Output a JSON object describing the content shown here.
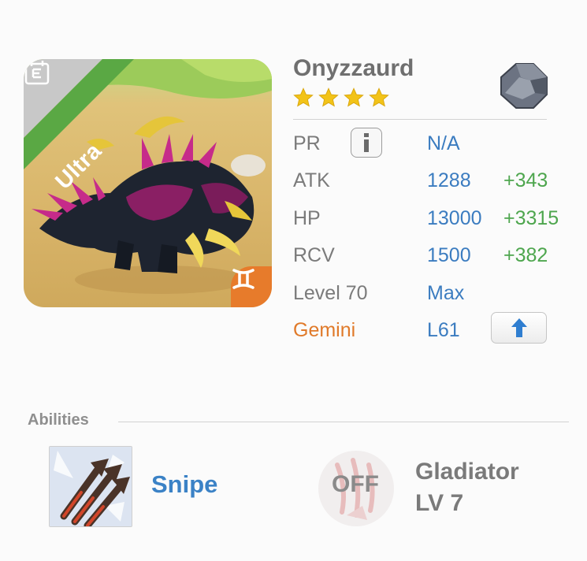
{
  "monster": {
    "name": "Onyzzaurd",
    "rarity_label": "Ultra",
    "star_count": 4,
    "element_icon": "dark-stone-icon",
    "zodiac_icon": "gemini-icon"
  },
  "stats": {
    "pr": {
      "label": "PR",
      "value": "N/A"
    },
    "atk": {
      "label": "ATK",
      "value": "1288",
      "bonus": "+343"
    },
    "hp": {
      "label": "HP",
      "value": "13000",
      "bonus": "+3315"
    },
    "rcv": {
      "label": "RCV",
      "value": "1500",
      "bonus": "+382"
    },
    "level": {
      "label": "Level 70",
      "value": "Max"
    },
    "zodiac": {
      "label": "Gemini",
      "value": "L61"
    }
  },
  "abilities": {
    "section_label": "Abilities",
    "primary": {
      "name": "Snipe",
      "icon": "triple-arrow-icon"
    },
    "secondary": {
      "status": "OFF",
      "name": "Gladiator",
      "level": "LV 7",
      "icon": "claw-icon"
    }
  },
  "colors": {
    "ultra_banner": "#5aa844",
    "zodiac_orange": "#e77b2b",
    "value_blue": "#3b7cc0",
    "bonus_green": "#4ea64e",
    "gemini_text": "#e07a2a"
  }
}
